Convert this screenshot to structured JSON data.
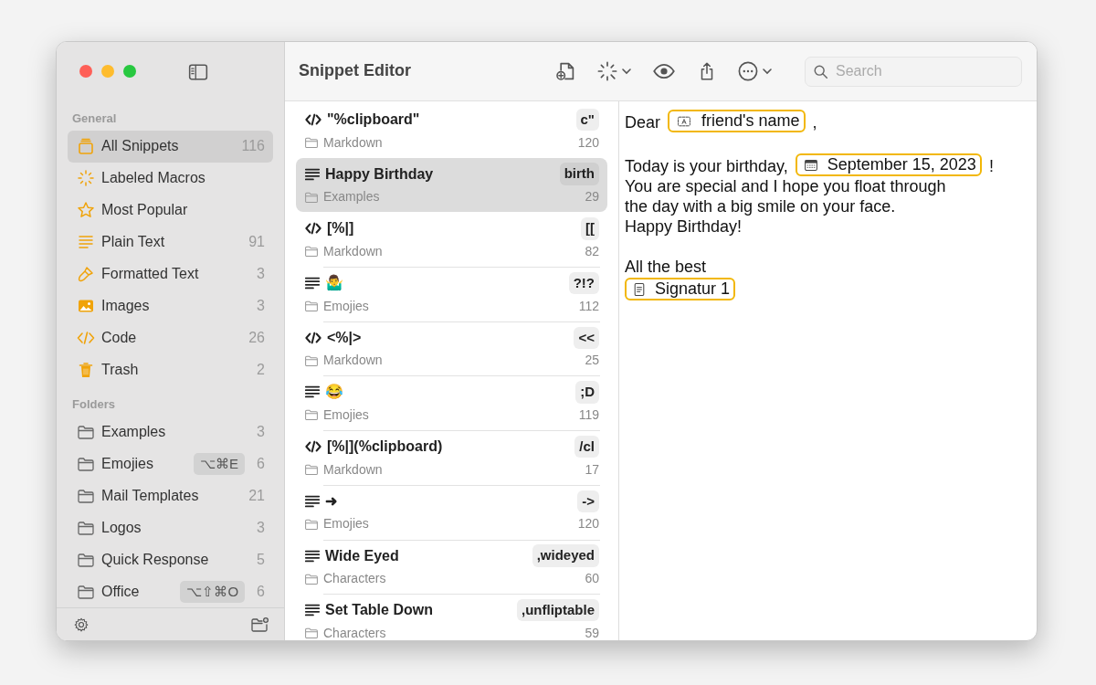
{
  "window": {
    "title": "Snippet Editor"
  },
  "sidebar": {
    "sections": [
      {
        "heading": "General",
        "items": [
          {
            "kind": "tray",
            "label": "All Snippets",
            "count": "116",
            "selected": true
          },
          {
            "kind": "sparkle",
            "label": "Labeled Macros",
            "selected": false
          },
          {
            "kind": "star",
            "label": "Most Popular",
            "selected": false
          },
          {
            "kind": "lines",
            "label": "Plain Text",
            "count": "91",
            "selected": false
          },
          {
            "kind": "brush",
            "label": "Formatted Text",
            "count": "3",
            "selected": false
          },
          {
            "kind": "image",
            "label": "Images",
            "count": "3",
            "selected": false
          },
          {
            "kind": "code",
            "label": "Code",
            "count": "26",
            "selected": false
          },
          {
            "kind": "trash",
            "label": "Trash",
            "count": "2",
            "selected": false
          }
        ]
      },
      {
        "heading": "Folders",
        "items": [
          {
            "kind": "folder",
            "label": "Examples",
            "count": "3",
            "selected": false
          },
          {
            "kind": "folder",
            "label": "Emojies",
            "shortcut": "⌥⌘E",
            "count": "6",
            "selected": false
          },
          {
            "kind": "folder",
            "label": "Mail Templates",
            "count": "21",
            "selected": false
          },
          {
            "kind": "folder",
            "label": "Logos",
            "count": "3",
            "selected": false
          },
          {
            "kind": "folder",
            "label": "Quick Response",
            "count": "5",
            "selected": false
          },
          {
            "kind": "folder",
            "label": "Office",
            "shortcut": "⌥⇧⌘O",
            "count": "6",
            "selected": false
          }
        ]
      }
    ]
  },
  "search": {
    "placeholder": "Search"
  },
  "snippets": [
    {
      "kind": "code",
      "title": "\"%clipboard\"",
      "abbreviation": "c\"",
      "folder": "Markdown",
      "count": "120",
      "selected": false
    },
    {
      "kind": "text",
      "title": "Happy Birthday",
      "abbreviation": "birth",
      "folder": "Examples",
      "count": "29",
      "selected": true
    },
    {
      "kind": "code",
      "title": "[%|]",
      "abbreviation": "[[",
      "folder": "Markdown",
      "count": "82",
      "selected": false
    },
    {
      "kind": "text",
      "title": "🤷‍♂️",
      "abbreviation": "?!?",
      "folder": "Emojies",
      "count": "112",
      "selected": false
    },
    {
      "kind": "code",
      "title": "<%|>",
      "abbreviation": "<<",
      "folder": "Markdown",
      "count": "25",
      "selected": false
    },
    {
      "kind": "text",
      "title": "😂",
      "abbreviation": ";D",
      "folder": "Emojies",
      "count": "119",
      "selected": false
    },
    {
      "kind": "code",
      "title": "[%|](%clipboard)",
      "abbreviation": "/cl",
      "folder": "Markdown",
      "count": "17",
      "selected": false
    },
    {
      "kind": "text",
      "title": "➜",
      "abbreviation": "->",
      "folder": "Emojies",
      "count": "120",
      "selected": false
    },
    {
      "kind": "text",
      "title": "Wide Eyed",
      "abbreviation": ",wideyed",
      "folder": "Characters",
      "count": "60",
      "selected": false
    },
    {
      "kind": "text",
      "title": "Set Table Down",
      "abbreviation": ",unfliptable",
      "folder": "Characters",
      "count": "59",
      "selected": false
    }
  ],
  "editor": {
    "paragraphs": [
      {
        "lines": [
          {
            "parts": [
              {
                "kind": "text",
                "text": "Dear"
              },
              {
                "kind": "field",
                "text": "friend's name"
              },
              {
                "kind": "text",
                "text": ","
              }
            ]
          }
        ]
      },
      {
        "lines": [
          {
            "parts": [
              {
                "kind": "text",
                "text": "Today is your birthday,"
              },
              {
                "kind": "date",
                "text": "September 15, 2023"
              },
              {
                "kind": "text",
                "text": "!"
              }
            ]
          },
          {
            "parts": [
              {
                "kind": "text",
                "text": "You are special and I hope you float through"
              }
            ]
          },
          {
            "parts": [
              {
                "kind": "text",
                "text": "the day with a big smile on your face."
              }
            ]
          },
          {
            "parts": [
              {
                "kind": "text",
                "text": "Happy Birthday!"
              }
            ]
          }
        ]
      },
      {
        "lines": [
          {
            "parts": [
              {
                "kind": "text",
                "text": "All the best"
              }
            ]
          },
          {
            "parts": [
              {
                "kind": "snippet",
                "text": "Signatur 1"
              }
            ]
          }
        ]
      }
    ]
  }
}
